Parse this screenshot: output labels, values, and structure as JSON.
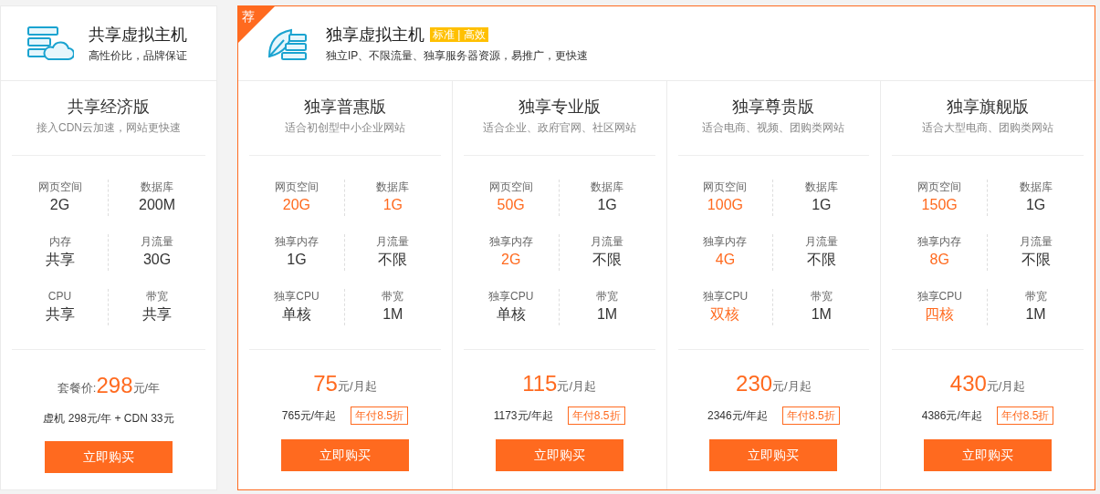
{
  "shared": {
    "title": "共享虚拟主机",
    "subtitle": "高性价比，品牌保证",
    "plan": {
      "name": "共享经济版",
      "desc": "接入CDN云加速，网站更快速",
      "specs": [
        {
          "label": "网页空间",
          "value": "2G",
          "highlight": false
        },
        {
          "label": "数据库",
          "value": "200M",
          "highlight": false
        },
        {
          "label": "内存",
          "value": "共享",
          "highlight": false
        },
        {
          "label": "月流量",
          "value": "30G",
          "highlight": false
        },
        {
          "label": "CPU",
          "value": "共享",
          "highlight": false
        },
        {
          "label": "带宽",
          "value": "共享",
          "highlight": false
        }
      ],
      "price_prefix": "套餐价:",
      "price": "298",
      "price_unit": "元/年",
      "note": "虚机 298元/年 + CDN 33元",
      "button": "立即购买"
    }
  },
  "dedicated": {
    "corner_badge": "荐",
    "title": "独享虚拟主机",
    "tag": "标准 | 高效",
    "subtitle": "独立IP、不限流量、独享服务器资源，易推广，更快速",
    "plans": [
      {
        "name": "独享普惠版",
        "desc": "适合初创型中小企业网站",
        "specs": [
          {
            "label": "网页空间",
            "value": "20G",
            "highlight": true
          },
          {
            "label": "数据库",
            "value": "1G",
            "highlight": true
          },
          {
            "label": "独享内存",
            "value": "1G",
            "highlight": false
          },
          {
            "label": "月流量",
            "value": "不限",
            "highlight": false
          },
          {
            "label": "独享CPU",
            "value": "单核",
            "highlight": false
          },
          {
            "label": "带宽",
            "value": "1M",
            "highlight": false
          }
        ],
        "price": "75",
        "price_unit": "元/月起",
        "yearly": "765元/年起",
        "discount": "年付8.5折",
        "button": "立即购买"
      },
      {
        "name": "独享专业版",
        "desc": "适合企业、政府官网、社区网站",
        "specs": [
          {
            "label": "网页空间",
            "value": "50G",
            "highlight": true
          },
          {
            "label": "数据库",
            "value": "1G",
            "highlight": false
          },
          {
            "label": "独享内存",
            "value": "2G",
            "highlight": true
          },
          {
            "label": "月流量",
            "value": "不限",
            "highlight": false
          },
          {
            "label": "独享CPU",
            "value": "单核",
            "highlight": false
          },
          {
            "label": "带宽",
            "value": "1M",
            "highlight": false
          }
        ],
        "price": "115",
        "price_unit": "元/月起",
        "yearly": "1173元/年起",
        "discount": "年付8.5折",
        "button": "立即购买"
      },
      {
        "name": "独享尊贵版",
        "desc": "适合电商、视频、团购类网站",
        "specs": [
          {
            "label": "网页空间",
            "value": "100G",
            "highlight": true
          },
          {
            "label": "数据库",
            "value": "1G",
            "highlight": false
          },
          {
            "label": "独享内存",
            "value": "4G",
            "highlight": true
          },
          {
            "label": "月流量",
            "value": "不限",
            "highlight": false
          },
          {
            "label": "独享CPU",
            "value": "双核",
            "highlight": true
          },
          {
            "label": "带宽",
            "value": "1M",
            "highlight": false
          }
        ],
        "price": "230",
        "price_unit": "元/月起",
        "yearly": "2346元/年起",
        "discount": "年付8.5折",
        "button": "立即购买"
      },
      {
        "name": "独享旗舰版",
        "desc": "适合大型电商、团购类网站",
        "specs": [
          {
            "label": "网页空间",
            "value": "150G",
            "highlight": true
          },
          {
            "label": "数据库",
            "value": "1G",
            "highlight": false
          },
          {
            "label": "独享内存",
            "value": "8G",
            "highlight": true
          },
          {
            "label": "月流量",
            "value": "不限",
            "highlight": false
          },
          {
            "label": "独享CPU",
            "value": "四核",
            "highlight": true
          },
          {
            "label": "带宽",
            "value": "1M",
            "highlight": false
          }
        ],
        "price": "430",
        "price_unit": "元/月起",
        "yearly": "4386元/年起",
        "discount": "年付8.5折",
        "button": "立即购买"
      }
    ]
  }
}
